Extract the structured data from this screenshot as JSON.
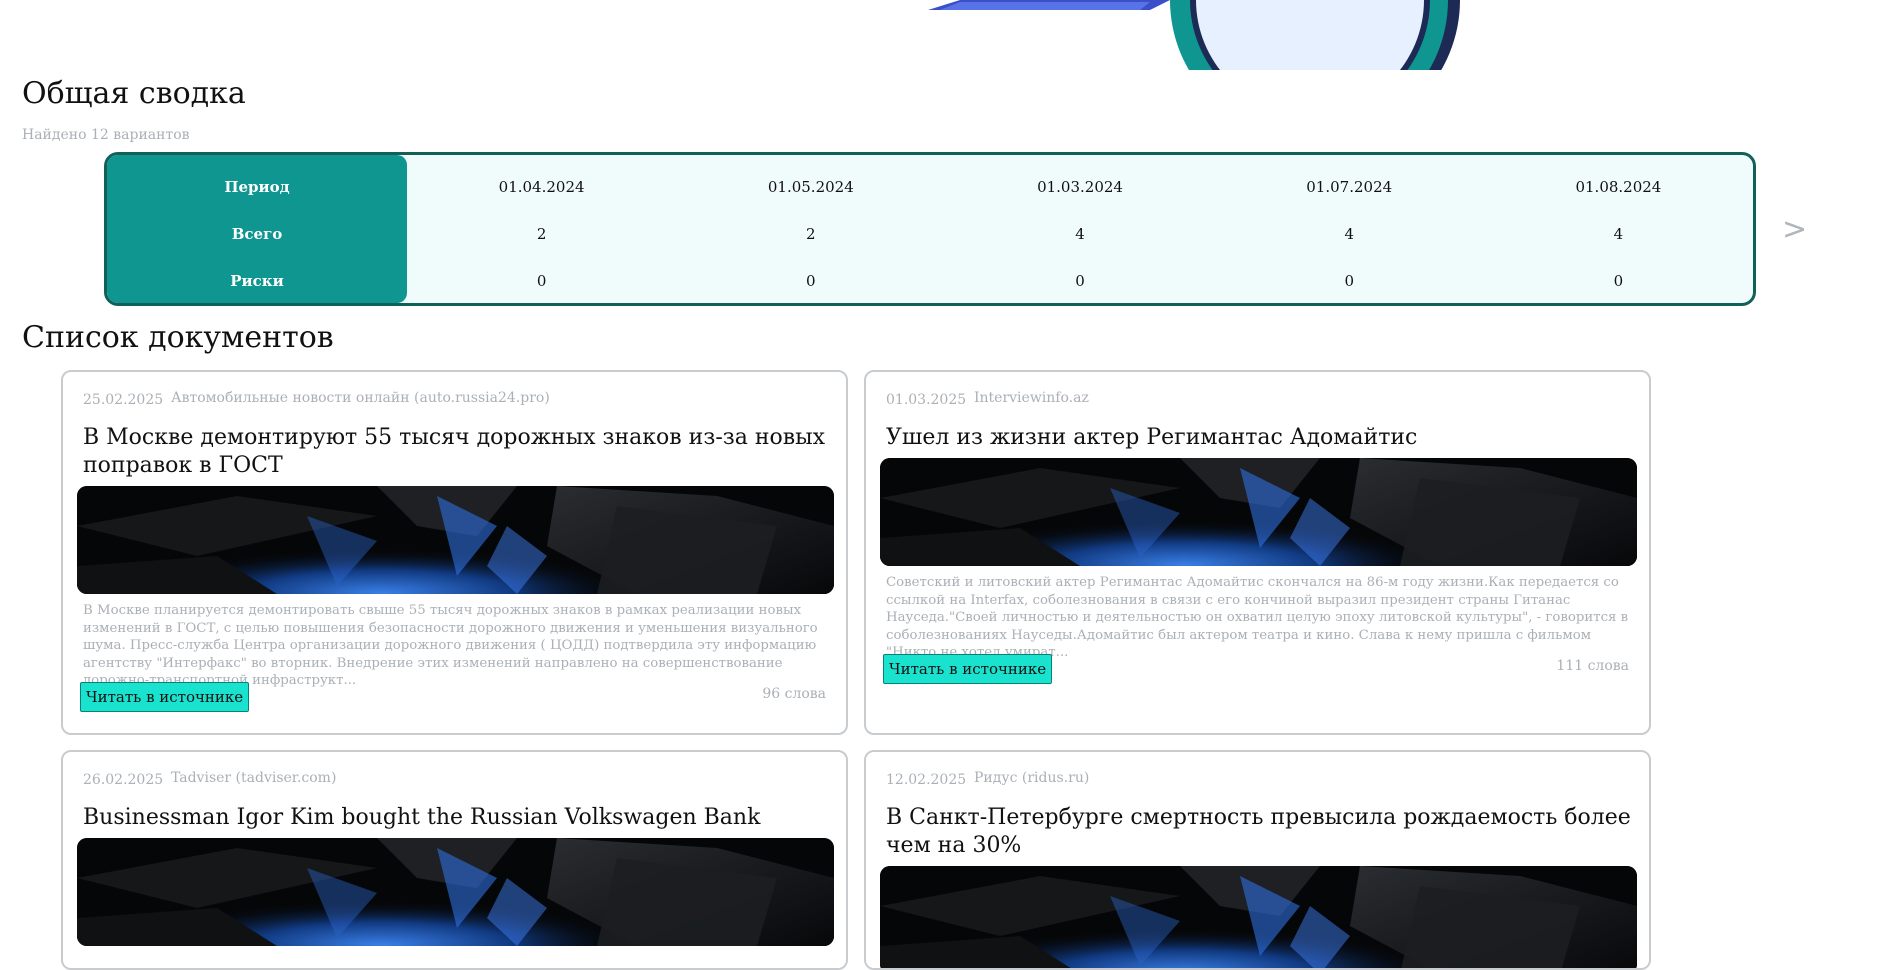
{
  "summary": {
    "title": "Общая сводка",
    "found": "Найдено 12 вариантов",
    "rows": [
      {
        "label": "Период",
        "cells": [
          "01.04.2024",
          "01.05.2024",
          "01.03.2024",
          "01.07.2024",
          "01.08.2024"
        ]
      },
      {
        "label": "Всего",
        "cells": [
          "2",
          "2",
          "4",
          "4",
          "4"
        ]
      },
      {
        "label": "Риски",
        "cells": [
          "0",
          "0",
          "0",
          "0",
          "0"
        ]
      }
    ],
    "next_label": ">"
  },
  "documents": {
    "title": "Список документов",
    "read_label": "Читать в источнике",
    "cards": [
      {
        "date": "25.02.2025",
        "source": "Автомобильные новости онлайн (auto.russia24.pro)",
        "title": "В Москве демонтируют 55 тысяч дорожных знаков из-за новых поправок в ГОСТ",
        "excerpt": "В Москве планируется демонтировать свыше 55 тысяч дорожных знаков в рамках реализации новых изменений в ГОСТ, с целью повышения безопасности дорожного движения и уменьшения визуального шума. Пресс-служба Центра организации дорожного движения ( ЦОДД) подтвердила эту информацию агентству \"Интерфакс\" во вторник. Внедрение этих изменений направлено на совершенствование дорожно-транспортной инфраструкт...",
        "words": "96 слова"
      },
      {
        "date": "01.03.2025",
        "source": "Interviewinfo.az",
        "title": "Ушел из жизни актер Регимантас Адомайтис",
        "excerpt": "Советский и литовский актер Регимантас Адомайтис скончался на 86-м году жизни.Как передается со ссылкой на Interfax, соболезнования в связи с его кончиной выразил президент страны Гитанас Науседа.\"Своей личностью и деятельностью он охватил целую эпоху литовской культуры\", - говорится в соболезнованиях Науседы.Адомайтис был актером театра и кино. Слава к нему пришла с фильмом \"Никто не хотел умират...",
        "words": "111 слова"
      },
      {
        "date": "26.02.2025",
        "source": "Tadviser (tadviser.com)",
        "title": "Businessman Igor Kim bought the Russian Volkswagen Bank",
        "excerpt": "",
        "words": ""
      },
      {
        "date": "12.02.2025",
        "source": "Ридус (ridus.ru)",
        "title": "В Санкт-Петербурге смертность превысила рождаемость более чем на 30%",
        "excerpt": "",
        "words": ""
      }
    ]
  },
  "colors": {
    "accent": "#0f9690",
    "accent_dark": "#11605a",
    "table_bg": "#effcfb",
    "button": "#19e3cf",
    "muted_text": "#aab0b6"
  }
}
